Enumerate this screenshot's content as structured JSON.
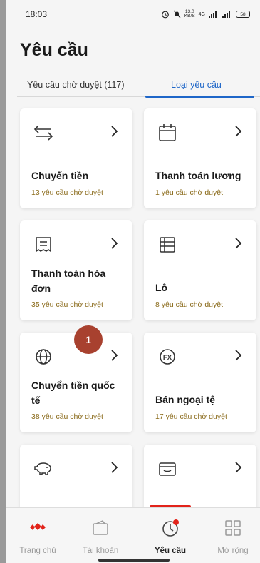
{
  "status": {
    "time": "18:03",
    "speed": "13.0",
    "speed_unit": "KB/S",
    "network": "4G",
    "battery": "58"
  },
  "header": {
    "title": "Yêu cầu"
  },
  "tabs": [
    {
      "label": "Yêu cầu chờ duyệt (117)"
    },
    {
      "label": "Loại yêu cầu"
    }
  ],
  "cards": [
    {
      "name": "Chuyển tiền",
      "sub": "13 yêu cầu chờ duyệt",
      "icon": "transfer-icon"
    },
    {
      "name": "Thanh toán lương",
      "sub": "1 yêu cầu chờ duyệt",
      "icon": "calendar-icon"
    },
    {
      "name": "Thanh toán hóa đơn",
      "sub": "35 yêu cầu chờ duyệt",
      "icon": "receipt-icon"
    },
    {
      "name": "Lô",
      "sub": "8 yêu cầu chờ duyệt",
      "icon": "table-icon"
    },
    {
      "name": "Chuyển tiền quốc tế",
      "sub": "38 yêu cầu chờ duyệt",
      "icon": "globe-icon"
    },
    {
      "name": "Bán ngoại tệ",
      "sub": "17 yêu cầu chờ duyệt",
      "icon": "fx-icon"
    },
    {
      "name": "",
      "sub": "",
      "icon": "piggy-bank-icon"
    },
    {
      "name": "",
      "sub": "",
      "icon": "card-icon"
    }
  ],
  "fx_icon_text": "FX",
  "annotation": {
    "badge": "1"
  },
  "nav": [
    {
      "label": "Trang chủ",
      "icon": "bank-logo-icon"
    },
    {
      "label": "Tài khoản",
      "icon": "wallet-icon"
    },
    {
      "label": "Yêu cầu",
      "icon": "clock-icon",
      "active": true
    },
    {
      "label": "Mở rộng",
      "icon": "grid-icon"
    }
  ],
  "colors": {
    "accent": "#1e66c8",
    "brand_red": "#e2231a",
    "pending_text": "#8a6a1a"
  }
}
